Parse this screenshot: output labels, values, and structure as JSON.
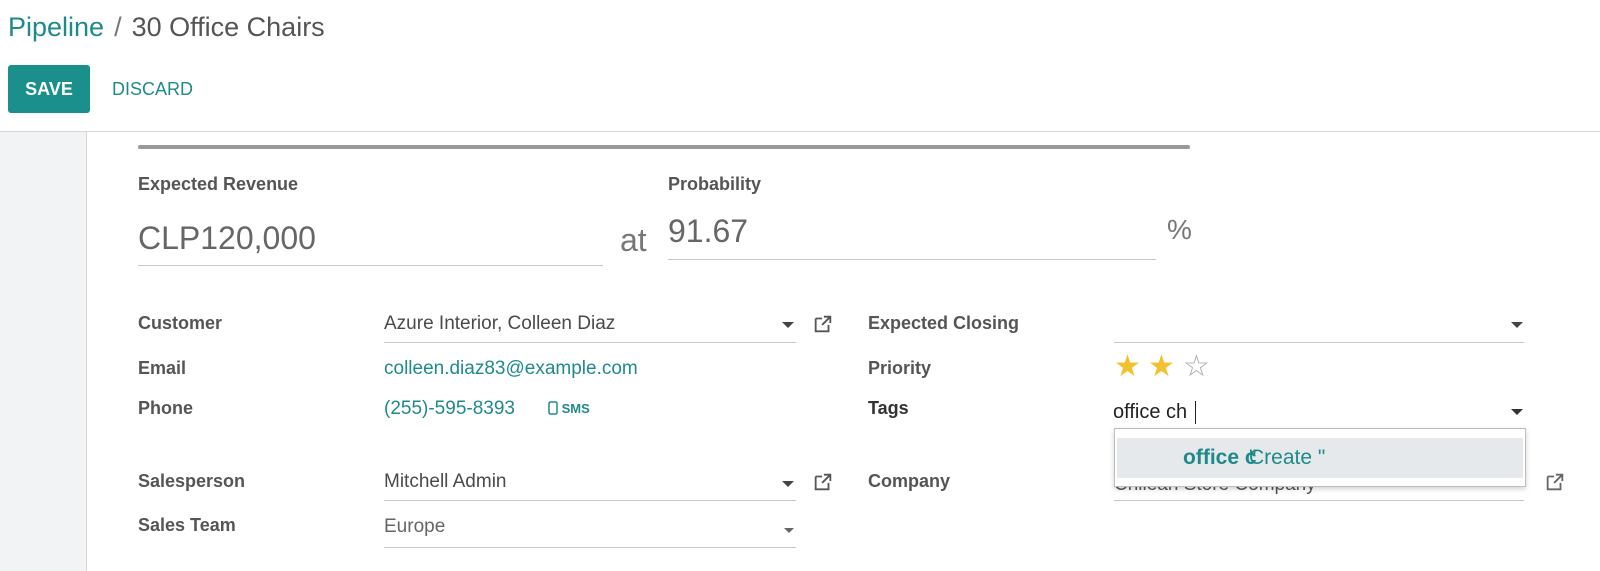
{
  "breadcrumb": {
    "parent": "Pipeline",
    "separator": "/",
    "current": "30 Office Chairs"
  },
  "toolbar": {
    "save_label": "SAVE",
    "discard_label": "DISCARD"
  },
  "form": {
    "expected_revenue": {
      "label": "Expected Revenue",
      "value": "CLP120,000"
    },
    "at_label": "at",
    "probability": {
      "label": "Probability",
      "value": "91.67",
      "unit": "%"
    },
    "customer": {
      "label": "Customer",
      "value": "Azure Interior, Colleen Diaz"
    },
    "email": {
      "label": "Email",
      "value": "colleen.diaz83@example.com"
    },
    "phone": {
      "label": "Phone",
      "value": "(255)-595-8393",
      "sms_label": "SMS"
    },
    "expected_closing": {
      "label": "Expected Closing",
      "value": ""
    },
    "priority": {
      "label": "Priority",
      "stars_total": 3,
      "stars_filled": 2
    },
    "tags": {
      "label": "Tags",
      "input_value": "office ch"
    },
    "salesperson": {
      "label": "Salesperson",
      "value": "Mitchell Admin"
    },
    "company": {
      "label": "Company",
      "value": "Chilean Store Company"
    },
    "sales_team": {
      "label": "Sales Team",
      "value": "Europe"
    }
  },
  "tags_dropdown": {
    "create_prefix": "Create \"",
    "create_term": "office c",
    "create_suffix": "\""
  },
  "colors": {
    "accent": "#1a8f8c",
    "link": "#1f8a8a",
    "star": "#f3c02e",
    "dropdown_highlight": "#e6e9eb"
  },
  "icons": {
    "external_link": "external-link-icon",
    "dropdown": "caret-down-icon",
    "mobile": "mobile-phone-icon",
    "star": "star-icon"
  }
}
